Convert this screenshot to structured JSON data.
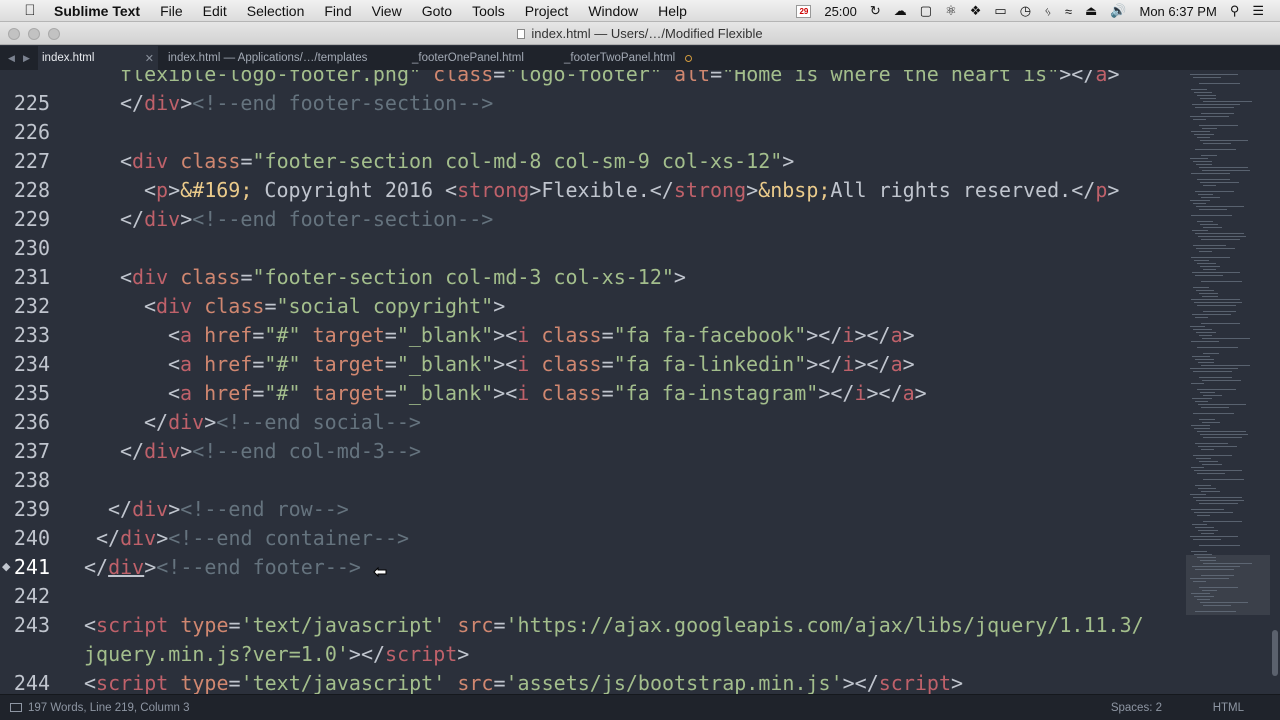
{
  "menubar": {
    "app_name": "Sublime Text",
    "items": [
      "File",
      "Edit",
      "Selection",
      "Find",
      "View",
      "Goto",
      "Tools",
      "Project",
      "Window",
      "Help"
    ],
    "status": {
      "calendar_day": "29",
      "timer": "25:00",
      "clock": "Mon 6:37 PM"
    }
  },
  "window": {
    "title": "index.html — Users/…/Modified Flexible"
  },
  "tabs": [
    {
      "label": "index.html",
      "active": true,
      "dirty": false
    },
    {
      "label": "index.html — Applications/…/templates",
      "active": false,
      "dirty": false
    },
    {
      "label": "_footerOnePanel.html",
      "active": false,
      "dirty": false
    },
    {
      "label": "_footerTwoPanel.html",
      "active": false,
      "dirty": true
    }
  ],
  "code_lines": [
    {
      "num": "",
      "tokens": [
        [
          "t-txt",
          "    "
        ],
        [
          "t-str",
          "flexible-logo-footer.png\""
        ],
        [
          "t-pun",
          " "
        ],
        [
          "t-attr",
          "class"
        ],
        [
          "t-pun",
          "="
        ],
        [
          "t-str",
          "\"logo-footer\""
        ],
        [
          "t-pun",
          " "
        ],
        [
          "t-attr",
          "alt"
        ],
        [
          "t-pun",
          "="
        ],
        [
          "t-str",
          "\"Home is where the heart is\""
        ],
        [
          "t-pun",
          "></"
        ],
        [
          "t-tag",
          "a"
        ],
        [
          "t-pun",
          ">"
        ]
      ]
    },
    {
      "num": "225",
      "tokens": [
        [
          "t-txt",
          "    "
        ],
        [
          "t-pun",
          "</"
        ],
        [
          "t-tag",
          "div"
        ],
        [
          "t-pun",
          ">"
        ],
        [
          "t-com",
          "<!--end footer-section-->"
        ]
      ]
    },
    {
      "num": "226",
      "tokens": []
    },
    {
      "num": "227",
      "tokens": [
        [
          "t-txt",
          "    "
        ],
        [
          "t-pun",
          "<"
        ],
        [
          "t-tag",
          "div"
        ],
        [
          "t-pun",
          " "
        ],
        [
          "t-attr",
          "class"
        ],
        [
          "t-pun",
          "="
        ],
        [
          "t-str",
          "\"footer-section col-md-8 col-sm-9 col-xs-12\""
        ],
        [
          "t-pun",
          ">"
        ]
      ]
    },
    {
      "num": "228",
      "tokens": [
        [
          "t-txt",
          "      "
        ],
        [
          "t-pun",
          "<"
        ],
        [
          "t-tag",
          "p"
        ],
        [
          "t-pun",
          ">"
        ],
        [
          "t-ent",
          "&#169;"
        ],
        [
          "t-txt",
          " Copyright 2016 "
        ],
        [
          "t-pun",
          "<"
        ],
        [
          "t-tag",
          "strong"
        ],
        [
          "t-pun",
          ">"
        ],
        [
          "t-txt",
          "Flexible."
        ],
        [
          "t-pun",
          "</"
        ],
        [
          "t-tag",
          "strong"
        ],
        [
          "t-pun",
          ">"
        ],
        [
          "t-ent",
          "&nbsp;"
        ],
        [
          "t-txt",
          "All rights reserved."
        ],
        [
          "t-pun",
          "</"
        ],
        [
          "t-tag",
          "p"
        ],
        [
          "t-pun",
          ">"
        ]
      ]
    },
    {
      "num": "229",
      "tokens": [
        [
          "t-txt",
          "    "
        ],
        [
          "t-pun",
          "</"
        ],
        [
          "t-tag",
          "div"
        ],
        [
          "t-pun",
          ">"
        ],
        [
          "t-com",
          "<!--end footer-section-->"
        ]
      ]
    },
    {
      "num": "230",
      "tokens": []
    },
    {
      "num": "231",
      "tokens": [
        [
          "t-txt",
          "    "
        ],
        [
          "t-pun",
          "<"
        ],
        [
          "t-tag",
          "div"
        ],
        [
          "t-pun",
          " "
        ],
        [
          "t-attr",
          "class"
        ],
        [
          "t-pun",
          "="
        ],
        [
          "t-str",
          "\"footer-section col-md-3 col-xs-12\""
        ],
        [
          "t-pun",
          ">"
        ]
      ]
    },
    {
      "num": "232",
      "tokens": [
        [
          "t-txt",
          "      "
        ],
        [
          "t-pun",
          "<"
        ],
        [
          "t-tag",
          "div"
        ],
        [
          "t-pun",
          " "
        ],
        [
          "t-attr",
          "class"
        ],
        [
          "t-pun",
          "="
        ],
        [
          "t-str",
          "\"social copyright\""
        ],
        [
          "t-pun",
          ">"
        ]
      ]
    },
    {
      "num": "233",
      "tokens": [
        [
          "t-txt",
          "        "
        ],
        [
          "t-pun",
          "<"
        ],
        [
          "t-tag",
          "a"
        ],
        [
          "t-pun",
          " "
        ],
        [
          "t-attr",
          "href"
        ],
        [
          "t-pun",
          "="
        ],
        [
          "t-str",
          "\"#\""
        ],
        [
          "t-pun",
          " "
        ],
        [
          "t-attr",
          "target"
        ],
        [
          "t-pun",
          "="
        ],
        [
          "t-str",
          "\"_blank\""
        ],
        [
          "t-pun",
          "><"
        ],
        [
          "t-tag",
          "i"
        ],
        [
          "t-pun",
          " "
        ],
        [
          "t-attr",
          "class"
        ],
        [
          "t-pun",
          "="
        ],
        [
          "t-str",
          "\"fa fa-facebook\""
        ],
        [
          "t-pun",
          "></"
        ],
        [
          "t-tag",
          "i"
        ],
        [
          "t-pun",
          "></"
        ],
        [
          "t-tag",
          "a"
        ],
        [
          "t-pun",
          ">"
        ]
      ]
    },
    {
      "num": "234",
      "tokens": [
        [
          "t-txt",
          "        "
        ],
        [
          "t-pun",
          "<"
        ],
        [
          "t-tag",
          "a"
        ],
        [
          "t-pun",
          " "
        ],
        [
          "t-attr",
          "href"
        ],
        [
          "t-pun",
          "="
        ],
        [
          "t-str",
          "\"#\""
        ],
        [
          "t-pun",
          " "
        ],
        [
          "t-attr",
          "target"
        ],
        [
          "t-pun",
          "="
        ],
        [
          "t-str",
          "\"_blank\""
        ],
        [
          "t-pun",
          "><"
        ],
        [
          "t-tag",
          "i"
        ],
        [
          "t-pun",
          " "
        ],
        [
          "t-attr",
          "class"
        ],
        [
          "t-pun",
          "="
        ],
        [
          "t-str",
          "\"fa fa-linkedin\""
        ],
        [
          "t-pun",
          "></"
        ],
        [
          "t-tag",
          "i"
        ],
        [
          "t-pun",
          "></"
        ],
        [
          "t-tag",
          "a"
        ],
        [
          "t-pun",
          ">"
        ]
      ]
    },
    {
      "num": "235",
      "tokens": [
        [
          "t-txt",
          "        "
        ],
        [
          "t-pun",
          "<"
        ],
        [
          "t-tag",
          "a"
        ],
        [
          "t-pun",
          " "
        ],
        [
          "t-attr",
          "href"
        ],
        [
          "t-pun",
          "="
        ],
        [
          "t-str",
          "\"#\""
        ],
        [
          "t-pun",
          " "
        ],
        [
          "t-attr",
          "target"
        ],
        [
          "t-pun",
          "="
        ],
        [
          "t-str",
          "\"_blank\""
        ],
        [
          "t-pun",
          "><"
        ],
        [
          "t-tag",
          "i"
        ],
        [
          "t-pun",
          " "
        ],
        [
          "t-attr",
          "class"
        ],
        [
          "t-pun",
          "="
        ],
        [
          "t-str",
          "\"fa fa-instagram\""
        ],
        [
          "t-pun",
          "></"
        ],
        [
          "t-tag",
          "i"
        ],
        [
          "t-pun",
          "></"
        ],
        [
          "t-tag",
          "a"
        ],
        [
          "t-pun",
          ">"
        ]
      ]
    },
    {
      "num": "236",
      "tokens": [
        [
          "t-txt",
          "      "
        ],
        [
          "t-pun",
          "</"
        ],
        [
          "t-tag",
          "div"
        ],
        [
          "t-pun",
          ">"
        ],
        [
          "t-com",
          "<!--end social-->"
        ]
      ]
    },
    {
      "num": "237",
      "tokens": [
        [
          "t-txt",
          "    "
        ],
        [
          "t-pun",
          "</"
        ],
        [
          "t-tag",
          "div"
        ],
        [
          "t-pun",
          ">"
        ],
        [
          "t-com",
          "<!--end col-md-3-->"
        ]
      ]
    },
    {
      "num": "238",
      "tokens": []
    },
    {
      "num": "239",
      "tokens": [
        [
          "t-txt",
          "   "
        ],
        [
          "t-pun",
          "</"
        ],
        [
          "t-tag",
          "div"
        ],
        [
          "t-pun",
          ">"
        ],
        [
          "t-com",
          "<!--end row-->"
        ]
      ]
    },
    {
      "num": "240",
      "tokens": [
        [
          "t-txt",
          "  "
        ],
        [
          "t-pun",
          "</"
        ],
        [
          "t-tag",
          "div"
        ],
        [
          "t-pun",
          ">"
        ],
        [
          "t-com",
          "<!--end container-->"
        ]
      ]
    },
    {
      "num": "241",
      "current": true,
      "bookmark": true,
      "tokens": [
        [
          "t-txt",
          " "
        ],
        [
          "t-pun",
          "</"
        ],
        [
          "t-tag underline",
          "div"
        ],
        [
          "t-pun",
          ">"
        ],
        [
          "t-com",
          "<!--end footer-->"
        ]
      ]
    },
    {
      "num": "242",
      "tokens": []
    },
    {
      "num": "243",
      "tokens": [
        [
          "t-txt",
          " "
        ],
        [
          "t-pun",
          "<"
        ],
        [
          "t-tag",
          "script"
        ],
        [
          "t-pun",
          " "
        ],
        [
          "t-attr",
          "type"
        ],
        [
          "t-pun",
          "="
        ],
        [
          "t-str",
          "'text/javascript'"
        ],
        [
          "t-pun",
          " "
        ],
        [
          "t-attr",
          "src"
        ],
        [
          "t-pun",
          "="
        ],
        [
          "t-str",
          "'https://ajax.googleapis.com/ajax/libs/jquery/1.11.3/"
        ]
      ]
    },
    {
      "num": "",
      "tokens": [
        [
          "t-txt",
          " "
        ],
        [
          "t-str",
          "jquery.min.js?ver=1.0'"
        ],
        [
          "t-pun",
          "></"
        ],
        [
          "t-tag",
          "script"
        ],
        [
          "t-pun",
          ">"
        ]
      ]
    },
    {
      "num": "244",
      "tokens": [
        [
          "t-txt",
          " "
        ],
        [
          "t-pun",
          "<"
        ],
        [
          "t-tag",
          "script"
        ],
        [
          "t-pun",
          " "
        ],
        [
          "t-attr",
          "type"
        ],
        [
          "t-pun",
          "="
        ],
        [
          "t-str",
          "'text/javascript'"
        ],
        [
          "t-pun",
          " "
        ],
        [
          "t-attr",
          "src"
        ],
        [
          "t-pun",
          "="
        ],
        [
          "t-str",
          "'assets/js/bootstrap.min.js'"
        ],
        [
          "t-pun",
          "></"
        ],
        [
          "t-tag",
          "script"
        ],
        [
          "t-pun",
          ">"
        ]
      ]
    }
  ],
  "statusbar": {
    "position": "197 Words, Line 219, Column 3",
    "indent": "Spaces: 2",
    "syntax": "HTML"
  },
  "theme": {
    "background": "#2b303b",
    "tag": "#bf616a",
    "attribute": "#d08770",
    "string": "#a3be8c",
    "comment": "#65737e",
    "entity": "#ebcb8b"
  }
}
